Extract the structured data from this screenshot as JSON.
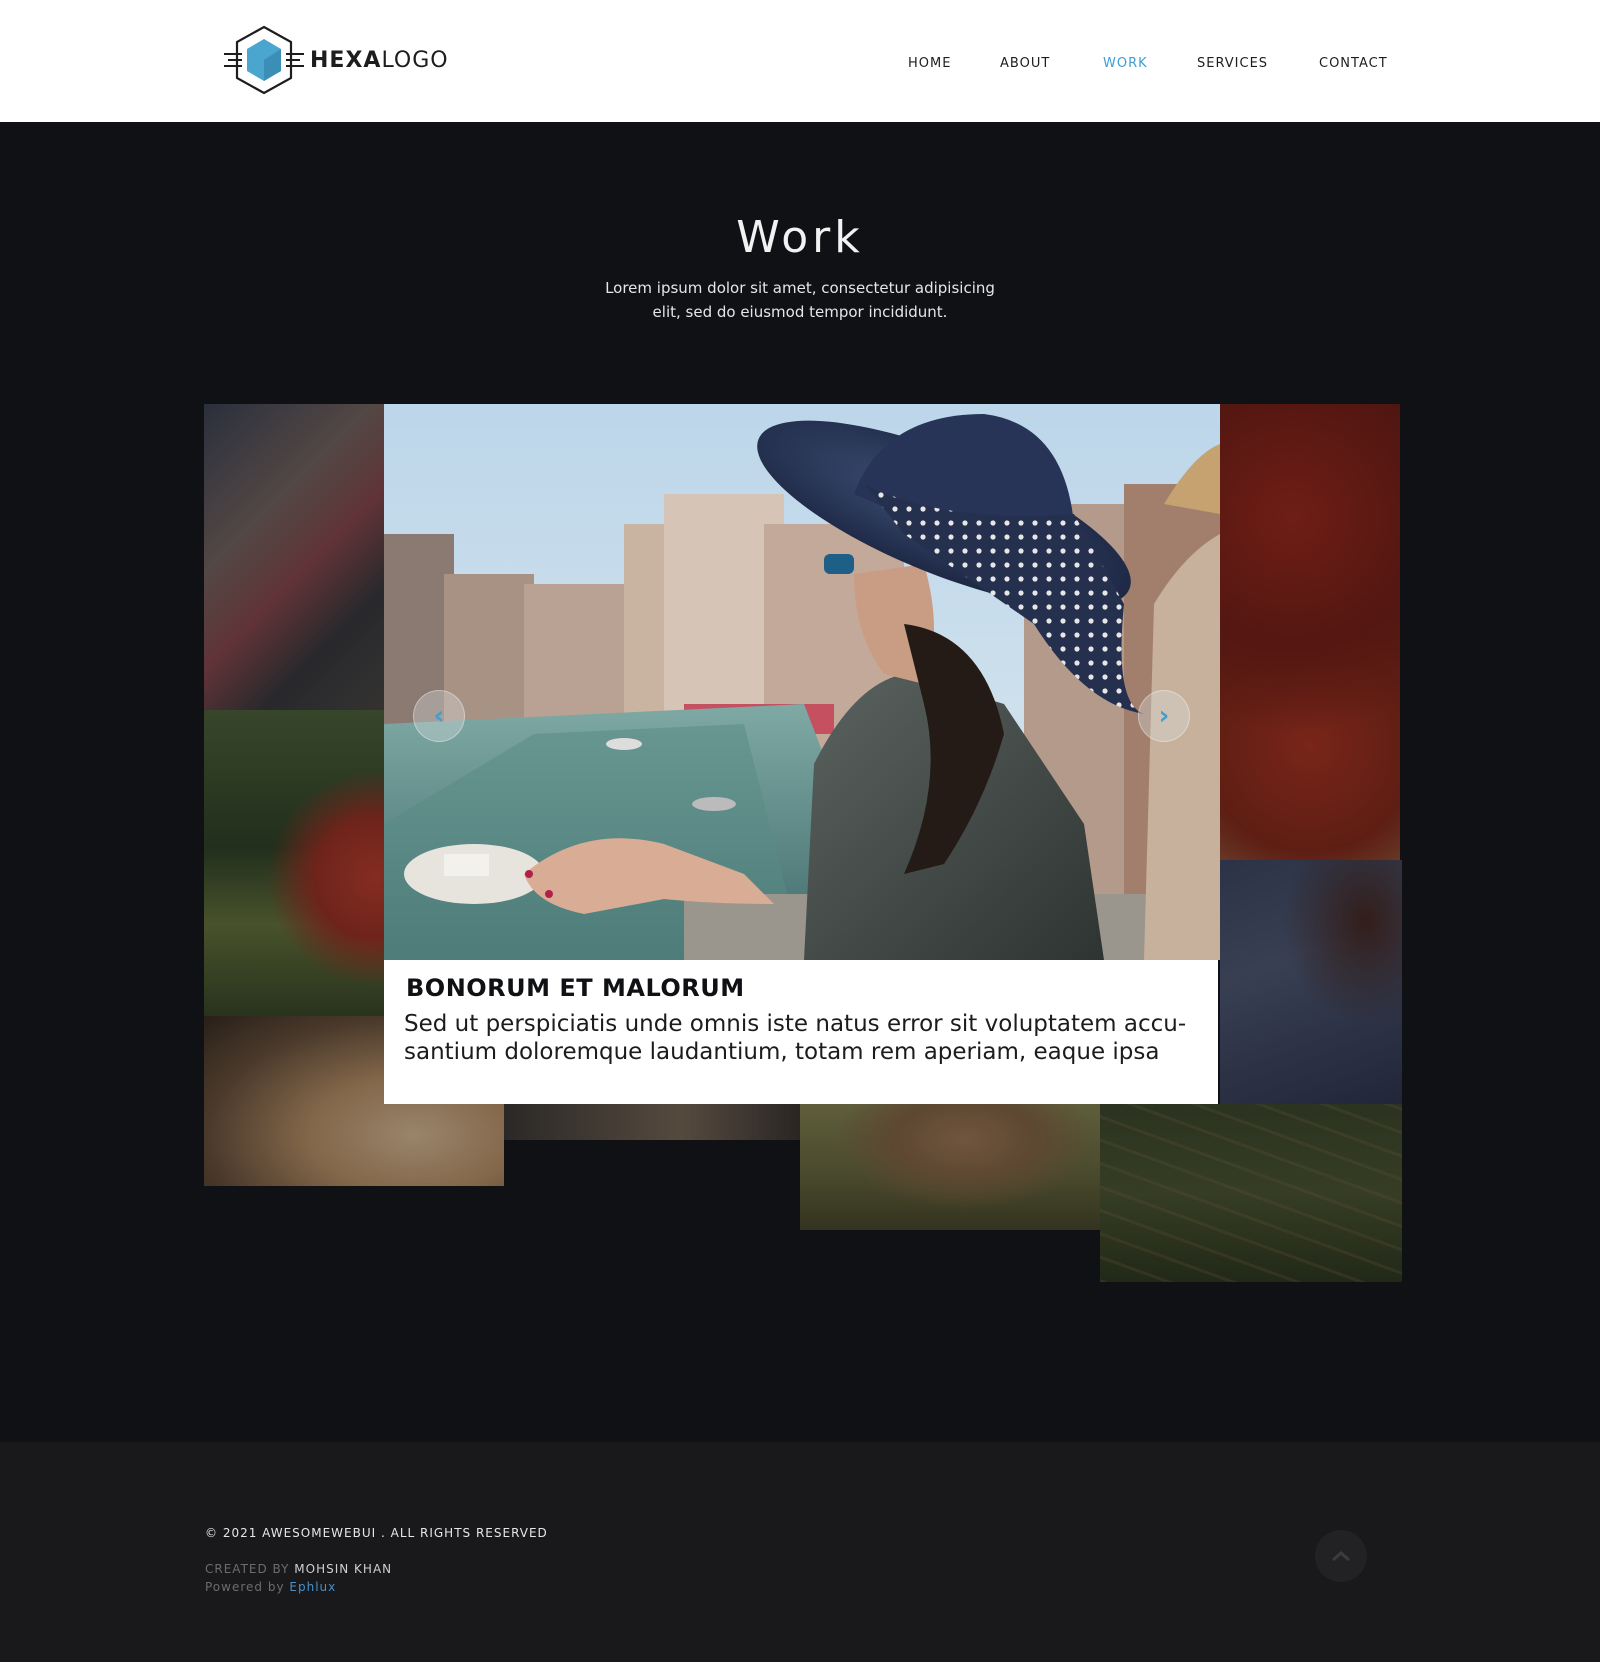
{
  "header": {
    "logo": {
      "bold": "HEXA",
      "light": "LOGO",
      "icon": "hexagon-logo-icon",
      "accent": "#4aa6cf"
    },
    "nav": [
      {
        "label": "HOME",
        "active": false
      },
      {
        "label": "ABOUT",
        "active": false
      },
      {
        "label": "WORK",
        "active": true
      },
      {
        "label": "SERVICES",
        "active": false
      },
      {
        "label": "CONTACT",
        "active": false
      }
    ],
    "active_color": "#3f9ed2"
  },
  "work": {
    "title": "Work",
    "subtitle_line1": "Lorem ipsum dolor sit amet, consectetur adipisicing",
    "subtitle_line2": "elit, sed do eiusmod tempor incididunt.",
    "slider": {
      "prev_icon": "chevron-left-icon",
      "next_icon": "chevron-right-icon",
      "prev_glyph": "‹",
      "next_glyph": "›",
      "caption_title": "BONORUM ET MALORUM",
      "caption_line1": "Sed ut perspiciatis unde omnis iste natus error sit voluptatem accu-",
      "caption_line2": "santium doloremque laudantium, totam rem aperiam, eaque ipsa"
    },
    "gallery_tiles": [
      "woman-in-hat",
      "poppy-flower",
      "pastry-plate",
      "sand",
      "dog-on-grass",
      "strawberries",
      "jacket-with-gloves",
      "pine-needles"
    ]
  },
  "footer": {
    "copyright": "© 2021 AWESOMEWEBUI . ALL RIGHTS RESERVED",
    "created_by_label": "CREATED BY",
    "created_by_name": "MOHSIN KHAN",
    "powered_by_label": "Powered by",
    "powered_by_link": "Ephlux",
    "back_to_top_icon": "chevron-up-icon"
  }
}
